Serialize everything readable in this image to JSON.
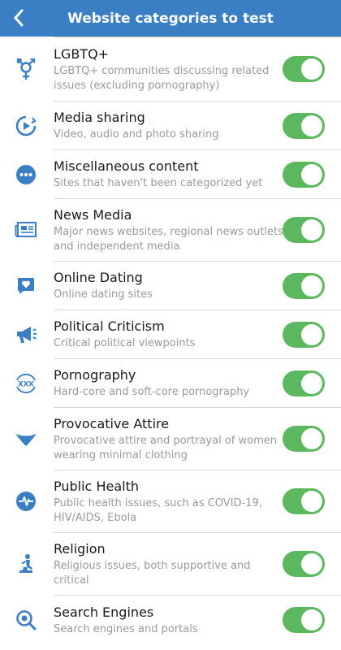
{
  "header": {
    "title": "Website categories to test",
    "back_icon": "chevron-left-icon"
  },
  "colors": {
    "header_bg": "#3a7fc4",
    "icon_blue": "#3a7fc4",
    "toggle_on": "#5bb85e"
  },
  "categories": [
    {
      "title": "LGBTQ+",
      "description": "LGBTQ+ communities discussing related issues (excluding pornography)",
      "icon": "transgender-symbol-icon",
      "enabled": true
    },
    {
      "title": "Media sharing",
      "description": "Video, audio and photo sharing",
      "icon": "play-circle-icon",
      "enabled": true
    },
    {
      "title": "Miscellaneous content",
      "description": "Sites that haven't been categorized yet",
      "icon": "more-dots-icon",
      "enabled": true
    },
    {
      "title": "News Media",
      "description": "Major news websites, regional news outlets and independent media",
      "icon": "newspaper-icon",
      "enabled": true
    },
    {
      "title": "Online Dating",
      "description": "Online dating sites",
      "icon": "heart-chat-icon",
      "enabled": true
    },
    {
      "title": "Political Criticism",
      "description": "Critical political viewpoints",
      "icon": "megaphone-icon",
      "enabled": true
    },
    {
      "title": "Pornography",
      "description": "Hard-core and soft-core pornography",
      "icon": "xxx-icon",
      "enabled": true
    },
    {
      "title": "Provocative Attire",
      "description": "Provocative attire and portrayal of women wearing minimal clothing",
      "icon": "bikini-icon",
      "enabled": true
    },
    {
      "title": "Public Health",
      "description": "Public health issues, such as COVID-19, HIV/AIDS, Ebola",
      "icon": "heartbeat-icon",
      "enabled": true
    },
    {
      "title": "Religion",
      "description": "Religious issues, both supportive and critical",
      "icon": "praying-person-icon",
      "enabled": true
    },
    {
      "title": "Search Engines",
      "description": "Search engines and portals",
      "icon": "search-magnifier-icon",
      "enabled": true
    }
  ]
}
